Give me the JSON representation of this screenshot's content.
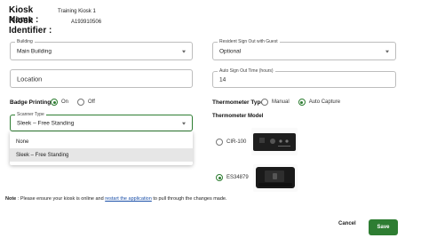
{
  "header": {
    "kiosk_name_label": "Kiosk Name :",
    "kiosk_name_value": "Training Kiosk 1",
    "kiosk_id_label": "Kiosk Identifier :",
    "kiosk_id_value": "A193910506"
  },
  "form": {
    "building": {
      "label": "Building",
      "value": "Main Building"
    },
    "resident_signout": {
      "label": "Resident Sign Out with Guest",
      "value": "Optional"
    },
    "location": {
      "placeholder": "Location"
    },
    "auto_signout": {
      "label": "Auto Sign Out Time (hours)",
      "value": "14"
    },
    "badge_printing": {
      "label": "Badge Printing",
      "options": [
        "On",
        "Off"
      ],
      "selected": "On"
    },
    "thermometer_type": {
      "label": "Thermometer Type",
      "options": [
        "Manual",
        "Auto Capture"
      ],
      "selected": "Auto Capture"
    },
    "scanner_type": {
      "label": "Scanner Type",
      "value": "Sleek – Free Standing",
      "menu_options": [
        "None",
        "Sleek – Free Standing"
      ],
      "highlighted": "Sleek – Free Standing"
    },
    "thermometer_model": {
      "label": "Thermometer Model",
      "options": [
        "CIR-100",
        "ES34879"
      ],
      "selected": "ES34879"
    }
  },
  "note": {
    "prefix": "Note",
    "text_before": " : Please ensure your kiosk is online and ",
    "link": "restart the application",
    "text_after": " to pull through the changes made."
  },
  "actions": {
    "cancel": "Cancel",
    "save": "Save"
  },
  "colors": {
    "accent": "#2e7d32",
    "link": "#1a4fa8"
  }
}
